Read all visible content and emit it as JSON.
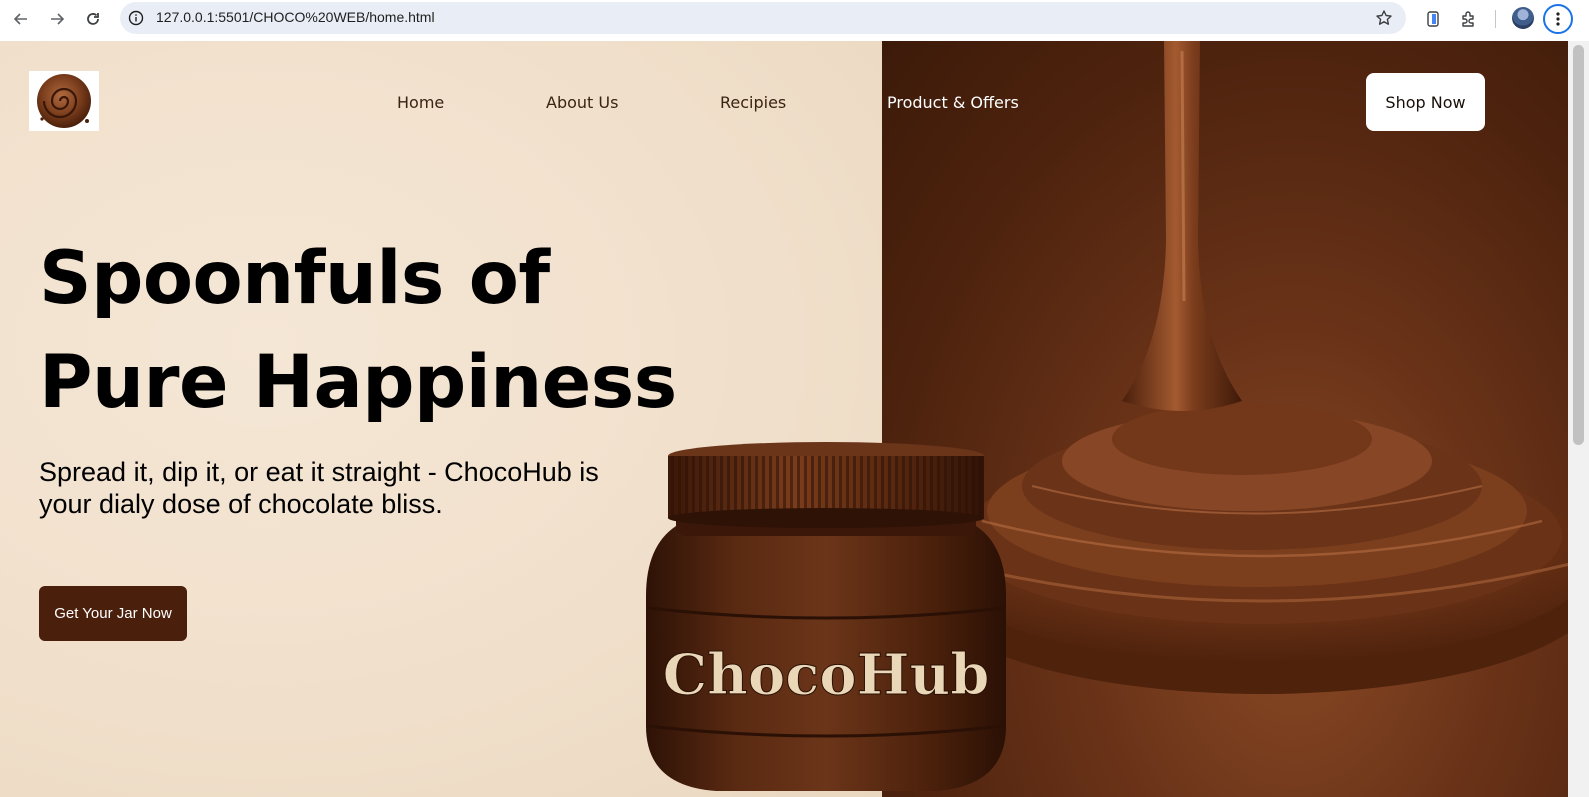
{
  "browser": {
    "url": "127.0.0.1:5501/CHOCO%20WEB/home.html"
  },
  "nav": {
    "links": [
      {
        "label": "Home"
      },
      {
        "label": "About Us"
      },
      {
        "label": "Recipies"
      },
      {
        "label": "Product & Offers"
      }
    ],
    "shop_button": "Shop Now"
  },
  "hero": {
    "headline_line1": "Spoonfuls of",
    "headline_line2": "Pure Happiness",
    "subtext": "Spread it, dip it, or eat it straight - ChocoHub is your dialy dose of chocolate bliss.",
    "cta_label": "Get Your Jar Now",
    "jar_label": "ChocoHub"
  },
  "colors": {
    "cream_background": "#f2e2cf",
    "chocolate_dark": "#4a1f0b",
    "chocolate_mid": "#6a3318",
    "omnibox": "#e9eef6"
  }
}
